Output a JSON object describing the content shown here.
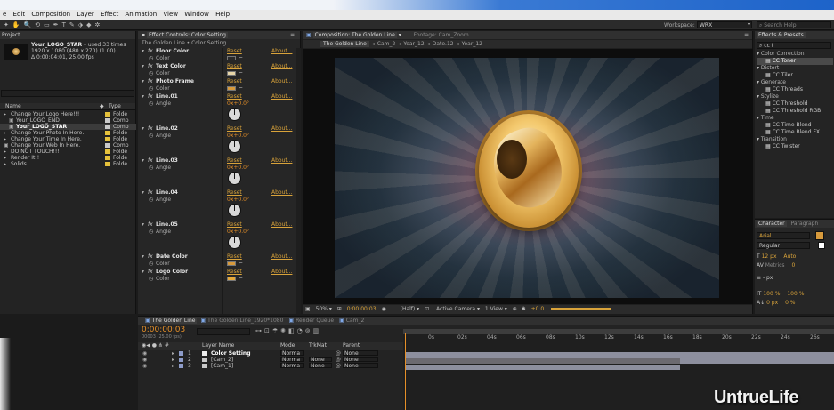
{
  "menubar": {
    "items": [
      "e",
      "Edit",
      "Composition",
      "Layer",
      "Effect",
      "Animation",
      "View",
      "Window",
      "Help"
    ]
  },
  "toolbar": {
    "workspace_label": "Workspace:",
    "workspace_value": "WRX",
    "search_placeholder": "Search Help"
  },
  "project": {
    "tab": "Project",
    "comp_name": "Your_LOGO_STAR",
    "used_text": "used 33 times",
    "res_text": "1920 x 1080 (480 x 270) (1.00)",
    "dur_text": "Δ 0:00:04:01, 25.00 fps",
    "col_name": "Name",
    "col_type": "Type",
    "items": [
      {
        "name": "Change Your Logo Here!!!",
        "type": "Folde",
        "color": "#e5c13b",
        "indent": 0
      },
      {
        "name": "Your_LOGO_END",
        "type": "Comp",
        "color": "#c9c9c9",
        "indent": 1
      },
      {
        "name": "Your_LOGO_STAR",
        "type": "Comp",
        "color": "#c9c9c9",
        "indent": 1
      },
      {
        "name": "Change Your Photo In Here.",
        "type": "Folde",
        "color": "#e5c13b",
        "indent": 0
      },
      {
        "name": "Change Your Time In Here.",
        "type": "Folde",
        "color": "#e5c13b",
        "indent": 0
      },
      {
        "name": "Change Your Web In Here.",
        "type": "Comp",
        "color": "#c9c9c9",
        "indent": 0
      },
      {
        "name": "DO NOT TOUCH!!!",
        "type": "Folde",
        "color": "#e5c13b",
        "indent": 0
      },
      {
        "name": "Render It!!",
        "type": "Folde",
        "color": "#e5c13b",
        "indent": 0
      },
      {
        "name": "Solids",
        "type": "Folde",
        "color": "#e5c13b",
        "indent": 0
      }
    ]
  },
  "effect_controls": {
    "tab": "Effect Controls: Color Setting",
    "header": "The Golden Line • Color Setting",
    "reset": "Reset",
    "about": "About...",
    "effects": [
      {
        "name": "Floor Color",
        "prop": "Color",
        "kind": "color",
        "swatch": "#2a2a2a"
      },
      {
        "name": "Text Color",
        "prop": "Color",
        "kind": "color",
        "swatch": "#e8d6a8"
      },
      {
        "name": "Photo Frame",
        "prop": "Color",
        "kind": "color",
        "swatch": "#d79a3c"
      },
      {
        "name": "Line.01",
        "prop": "Angle",
        "kind": "angle",
        "value": "0x+0.0°"
      },
      {
        "name": "Line.02",
        "prop": "Angle",
        "kind": "angle",
        "value": "0x+0.0°"
      },
      {
        "name": "Line.03",
        "prop": "Angle",
        "kind": "angle",
        "value": "0x+0.0°"
      },
      {
        "name": "Line.04",
        "prop": "Angle",
        "kind": "angle",
        "value": "0x+0.0°"
      },
      {
        "name": "Line.05",
        "prop": "Angle",
        "kind": "angle",
        "value": "0x+0.0°"
      },
      {
        "name": "Date Color",
        "prop": "Color",
        "kind": "color",
        "swatch": "#d79a3c"
      },
      {
        "name": "Logo Color",
        "prop": "Color",
        "kind": "color",
        "swatch": "#e5a93a"
      }
    ]
  },
  "composition": {
    "tab": "Composition: The Golden Line",
    "footage_tab": "Footage: Cam_Zoom",
    "breadcrumbs": [
      "The Golden Line",
      "Cam_2",
      "Year_12",
      "Date.12",
      "Year_12"
    ],
    "viewer_bar": {
      "zoom": "50%",
      "timecode": "0:00:00:03",
      "resolution": "(Half)",
      "camera": "Active Camera",
      "views": "1 View",
      "exposure": "+0.0"
    }
  },
  "effects_presets": {
    "tab": "Effects & Presets",
    "search": "cc t",
    "categories": [
      {
        "name": "Color Correction",
        "items": [
          "CC Toner"
        ]
      },
      {
        "name": "Distort",
        "items": [
          "CC Tiler"
        ]
      },
      {
        "name": "Generate",
        "items": [
          "CC Threads"
        ]
      },
      {
        "name": "Stylize",
        "items": [
          "CC Threshold",
          "CC Threshold RGB"
        ]
      },
      {
        "name": "Time",
        "items": [
          "CC Time Blend",
          "CC Time Blend FX"
        ]
      },
      {
        "name": "Transition",
        "items": [
          "CC Twister"
        ]
      }
    ]
  },
  "character": {
    "tab": "Character",
    "tab2": "Paragraph",
    "font": "Arial",
    "style": "Regular",
    "size": "12 px",
    "tracking": "0",
    "leading": "Auto",
    "kerning": "Metrics",
    "stroke": "- px",
    "vscale": "100 %",
    "hscale": "100 %",
    "baseline": "0 px",
    "tsume": "0 %"
  },
  "timeline": {
    "tabs": [
      "The Golden Line",
      "The Golden Line_1920*1080",
      "Render Queue",
      "Cam_2"
    ],
    "timecode": "0:00:00:03",
    "timecode_sub": "00003 (25.00 fps)",
    "cols": {
      "name": "Layer Name",
      "mode": "Mode",
      "trkmat": "TrkMat",
      "parent": "Parent"
    },
    "layers": [
      {
        "num": "1",
        "name": "Color Setting",
        "mode": "Norma",
        "trkmat": "",
        "parent": "None",
        "color": "#eeeeee"
      },
      {
        "num": "2",
        "name": "[Cam_2]",
        "mode": "Norma",
        "trkmat": "None",
        "parent": "None",
        "color": "#c9c9c9"
      },
      {
        "num": "3",
        "name": "[Cam_1]",
        "mode": "Norma",
        "trkmat": "None",
        "parent": "None",
        "color": "#c9c9c9"
      }
    ],
    "ruler": [
      "0s",
      "02s",
      "04s",
      "06s",
      "08s",
      "10s",
      "12s",
      "14s",
      "16s",
      "18s",
      "20s",
      "22s",
      "24s",
      "26s",
      "28s"
    ]
  },
  "watermark": "UntrueLife"
}
